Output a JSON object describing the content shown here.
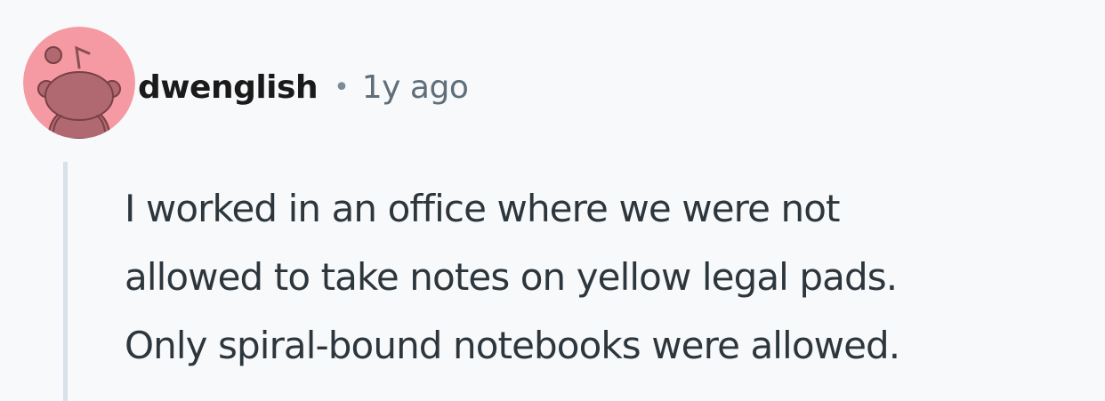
{
  "comment": {
    "author": "dwenglish",
    "separator": "•",
    "timestamp": "1y ago",
    "avatar_icon": "reddit-snoo-avatar-icon",
    "avatar_background": "#f59aa2",
    "body_lines": [
      "I worked in an office where we were not",
      "allowed to take notes on yellow legal pads.",
      "Only spiral-bound notebooks were allowed."
    ]
  }
}
